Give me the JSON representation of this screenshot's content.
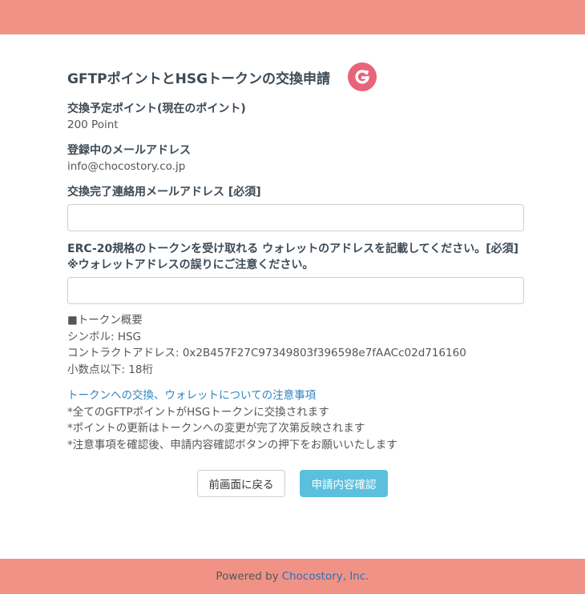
{
  "header": {
    "title": "GFTPポイントとHSGトークンの交換申請",
    "logo_icon": "g-logo-icon"
  },
  "fields": {
    "exchange_points_label": "交換予定ポイント(現在のポイント)",
    "exchange_points_value": "200 Point",
    "registered_email_label": "登録中のメールアドレス",
    "registered_email_value": "info@chocostory.co.jp",
    "contact_email_label": "交換完了連絡用メールアドレス [必須]",
    "contact_email_value": "",
    "wallet_label_line1": "ERC-20規格のトークンを受け取れる ウォレットのアドレスを記載してください。[必須]",
    "wallet_label_line2": "※ウォレットアドレスの誤りにご注意ください。",
    "wallet_address_value": ""
  },
  "token_info": {
    "heading": "■トークン概要",
    "symbol": "シンボル: HSG",
    "contract": "コントラクトアドレス: 0x2B457F27C97349803f396598e7fAACc02d716160",
    "decimals": "小数点以下: 18桁"
  },
  "notes": {
    "link_text": "トークンへの交換、ウォレットについての注意事項",
    "line1": "*全てのGFTPポイントがHSGトークンに交換されます",
    "line2": "*ポイントの更新はトークンへの変更が完了次第反映されます",
    "line3": "*注意事項を確認後、申請内容確認ボタンの押下をお願いいたします"
  },
  "buttons": {
    "back_label": "前画面に戻る",
    "confirm_label": "申請内容確認"
  },
  "footer": {
    "powered_by": "Powered by",
    "company_link": "Chocostory, Inc."
  },
  "colors": {
    "accent_bar": "#f09386",
    "logo": "#e8647a",
    "confirm_button": "#5bc0de",
    "link": "#2e86c1"
  }
}
